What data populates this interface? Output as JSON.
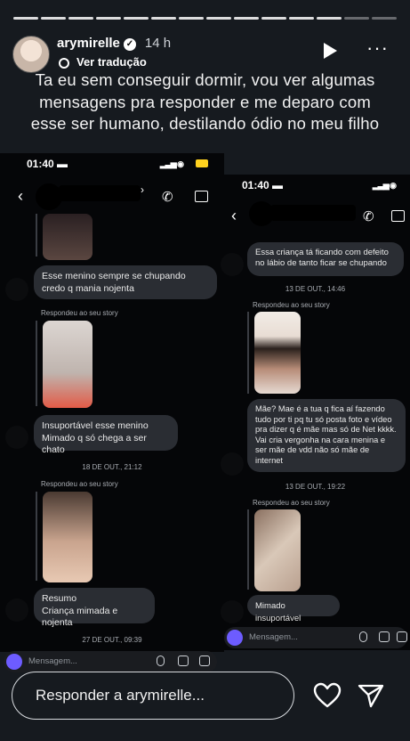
{
  "story": {
    "username": "arymirelle",
    "time": "14 h",
    "translate": "Ver tradução",
    "caption": "Ta eu sem conseguir dormir, vou ver algumas mensagens pra responder e me deparo com esse ser humano, destilando ódio no meu filho",
    "reply_placeholder": "Responder a arymirelle..."
  },
  "shot1": {
    "clock": "01:40",
    "msg1": "Esse menino sempre se chupando credo q mania nojenta",
    "responded1": "Respondeu ao seu story",
    "msg2": "Insuportável esse menino Mimado q só chega a ser chato",
    "date1": "18 DE OUT., 21:12",
    "responded2": "Respondeu ao seu story",
    "msg3a": "Resumo",
    "msg3b": "Criança mimada e nojenta",
    "date2": "27 DE OUT., 09:39",
    "placeholder": "Mensagem..."
  },
  "shot2": {
    "clock": "01:40",
    "msg1": "Essa criança tá ficando com defeito no lábio de tanto ficar se chupando",
    "date1": "13 DE OUT., 14:46",
    "responded1": "Respondeu ao seu story",
    "msg2": "Mãe? Mae é a tua q fica aí fazendo tudo por ti pq tu só posta foto e vídeo pra dizer q é mãe mas só de Net kkkk. Vai cria vergonha na cara menina e ser mãe de vdd não só mãe de internet",
    "date2": "13 DE OUT., 19:22",
    "responded2": "Respondeu ao seu story",
    "msg3": "Mimado insuportável",
    "placeholder": "Mensagem..."
  }
}
